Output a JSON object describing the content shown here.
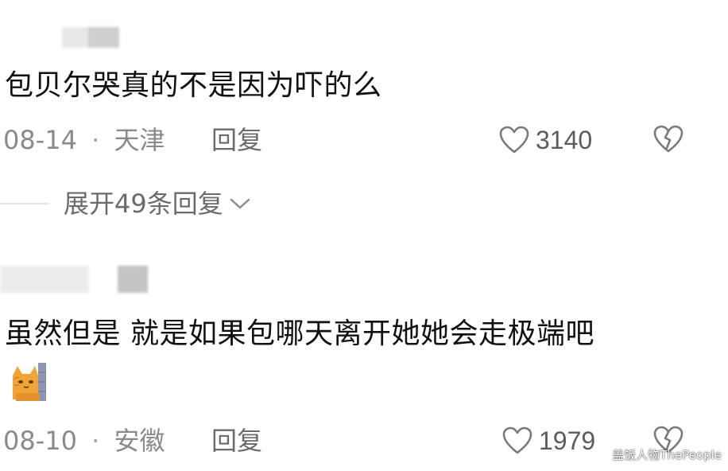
{
  "comments": [
    {
      "text": "包贝尔哭真的不是因为吓的么",
      "date": "08-14",
      "separator": "·",
      "location": "天津",
      "reply_label": "回复",
      "likes": "3140",
      "expand_label": "展开49条回复"
    },
    {
      "text": "虽然但是  就是如果包哪天离开她她会走极端吧",
      "date": "08-10",
      "separator": "·",
      "location": "安徽",
      "reply_label": "回复",
      "likes": "1979"
    }
  ],
  "watermark": "盖饭人物ThePeople",
  "colors": {
    "meta_gray": "#8a8a8a",
    "icon_gray": "#7a7a7a",
    "blur_gray": "#d8d8d8"
  },
  "icons": [
    "heart-outline-icon",
    "broken-heart-icon",
    "chevron-down-icon",
    "cat-emoji"
  ]
}
